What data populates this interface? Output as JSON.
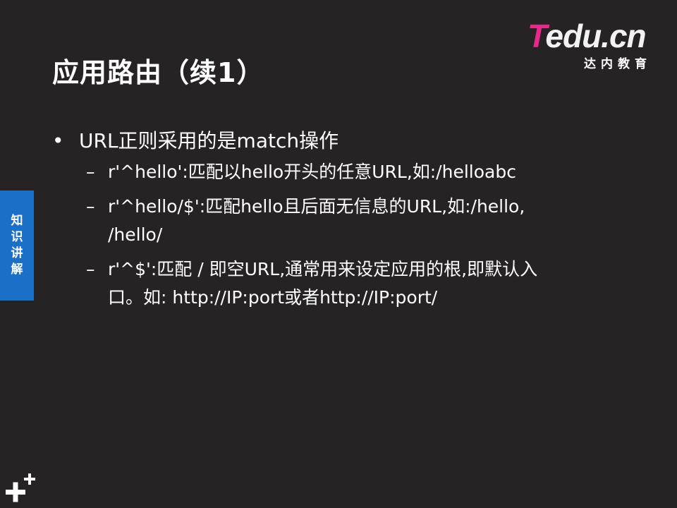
{
  "slide": {
    "title": "应用路由（续1）",
    "side_tab_chars": [
      "知",
      "识",
      "讲",
      "解"
    ],
    "logo": {
      "main_first": "T",
      "main_rest": "edu.cn",
      "sub": "达内教育"
    },
    "bullet_char": "•",
    "dash_char": "–",
    "bullet": "URL正则采用的是match操作",
    "subitems": [
      "r'^hello':匹配以hello开头的任意URL,如:/helloabc",
      "r'^hello/$':匹配hello且后面无信息的URL,如:/hello,",
      "/hello/",
      "r'^$':匹配 / 即空URL,通常用来设定应用的根,即默认入",
      "口。如: http://IP:port或者http://IP:port/"
    ]
  },
  "colors": {
    "background": "#262324",
    "side_tab": "#1a6fc6",
    "logo_accent": "#e8288a"
  }
}
